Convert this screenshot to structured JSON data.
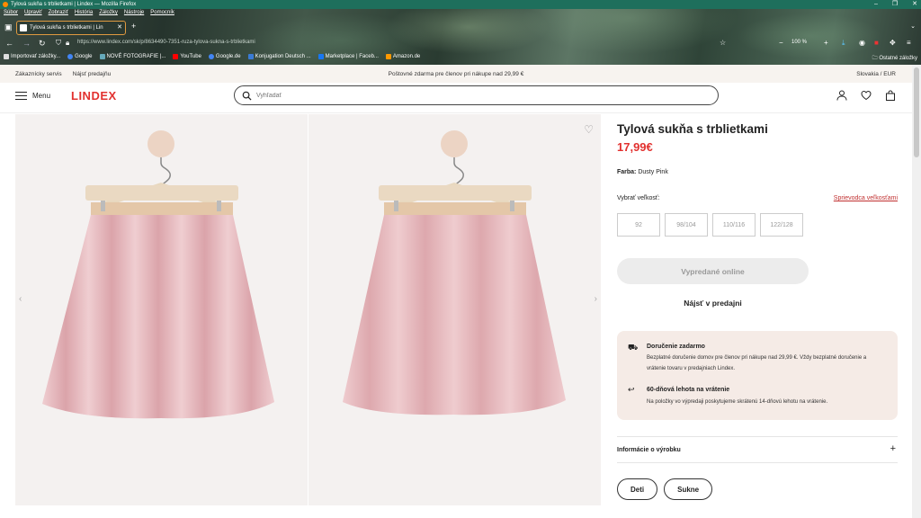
{
  "browser": {
    "window_title": "Tylová sukňa s trblietkami | Lindex — Mozilla Firefox",
    "menu": [
      "Súbor",
      "Upraviť",
      "Zobraziť",
      "História",
      "Záložky",
      "Nástroje",
      "Pomocník"
    ],
    "tab_title": "Tylová sukňa s trblietkami | Lin",
    "url": "https://www.lindex.com/sk/p/8634490-7351-ruza-tylova-sukna-s-trblietkami",
    "zoom": "100 %",
    "bookmarks": [
      "Importovať záložky...",
      "Google",
      "NOVÉ FOTOGRAFIE |...",
      "YouTube",
      "Google.de",
      "Konjugation Deutsch ...",
      "Marketplace | Faceb...",
      "Amazon.de"
    ],
    "other_bookmarks": "Ostatné záložky"
  },
  "utility_bar": {
    "customer_service": "Zákaznícky servis",
    "find_store": "Nájsť predajňu",
    "promo": "Poštovné zdarma pre členov pri nákupe nad 29,99 €",
    "region": "Slovakia / EUR"
  },
  "header": {
    "menu_label": "Menu",
    "logo": "LINDEX",
    "search_placeholder": "Vyhľadať"
  },
  "product": {
    "title": "Tylová sukňa s trblietkami",
    "price": "17,99€",
    "color_label": "Farba:",
    "color_value": "Dusty Pink",
    "size_label": "Vybrať veľkosť:",
    "size_guide": "Sprievodca veľkosťami",
    "sizes": [
      "92",
      "98/104",
      "110/116",
      "122/128"
    ],
    "sold_out": "Vypredané online",
    "find_in_store": "Nájsť v predajni"
  },
  "info_box": {
    "delivery_title": "Doručenie zadarmo",
    "delivery_text": "Bezplatné doručenie domov pre členov pri nákupe nad 29,99 €. Vždy bezplatné doručenie a vrátenie tovaru v predajniach Lindex.",
    "return_title": "60-dňová lehota na vrátenie",
    "return_text": "Na položky vo výpredaji poskytujeme skrátenú 14-dňovú lehotu na vrátenie."
  },
  "product_info": {
    "label": "Informácie o výrobku",
    "expand": "+"
  },
  "chips": [
    "Deti",
    "Sukne"
  ],
  "colors": {
    "accent": "#e2312f",
    "skirt": "#e9b8bc",
    "info_bg": "#f5ebe6"
  }
}
